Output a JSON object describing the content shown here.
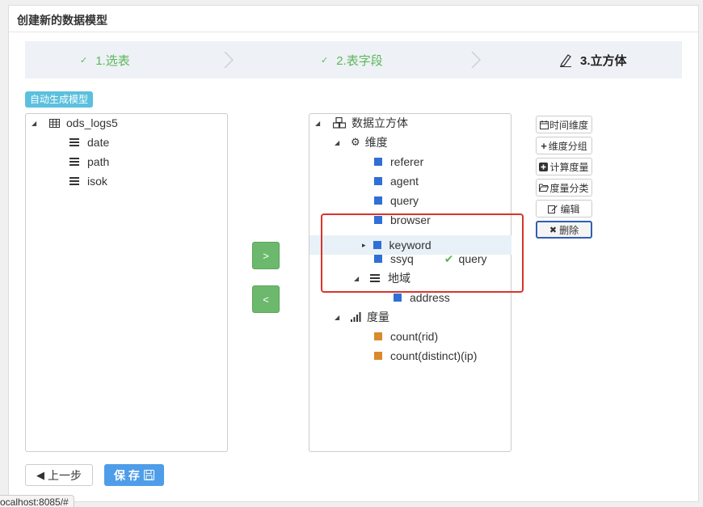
{
  "panel": {
    "title": "创建新的数据模型"
  },
  "steps": [
    {
      "label": "1.选表",
      "state": "done",
      "icon": "check-icon"
    },
    {
      "label": "2.表字段",
      "state": "done",
      "icon": "check-icon"
    },
    {
      "label": "3.立方体",
      "state": "active",
      "icon": "pencil-icon"
    }
  ],
  "auto_generate_label": "自动生成模型",
  "left_tree": {
    "table": "ods_logs5",
    "fields": [
      "date",
      "path",
      "isok"
    ]
  },
  "right_tree": {
    "root": "数据立方体",
    "dimension_group": "维度",
    "dimensions": [
      "referer",
      "agent",
      "query",
      "browser",
      "keyword",
      "ssyq"
    ],
    "ssyq_extra": "query",
    "region_group": "地域",
    "region_items": [
      "address"
    ],
    "measure_group": "度量",
    "measures": [
      "count(rid)",
      "count(distinct)(ip)"
    ]
  },
  "move_buttons": {
    "right": ">",
    "left": "<"
  },
  "side_buttons": {
    "time_dim": "时间维度",
    "dim_group": "维度分组",
    "calc_measure": "计算度量",
    "measure_category": "度量分类",
    "edit": "编辑",
    "delete": "删除"
  },
  "footer": {
    "prev": "上一步",
    "save": "保 存"
  },
  "status_url": "ocalhost:8085/#",
  "colors": {
    "success": "#5cb85c",
    "primary": "#4f9de8",
    "info": "#5bc0de",
    "highlight_border": "#d9342b",
    "dimension": "#2f6fd6",
    "measure": "#d98a2b"
  }
}
